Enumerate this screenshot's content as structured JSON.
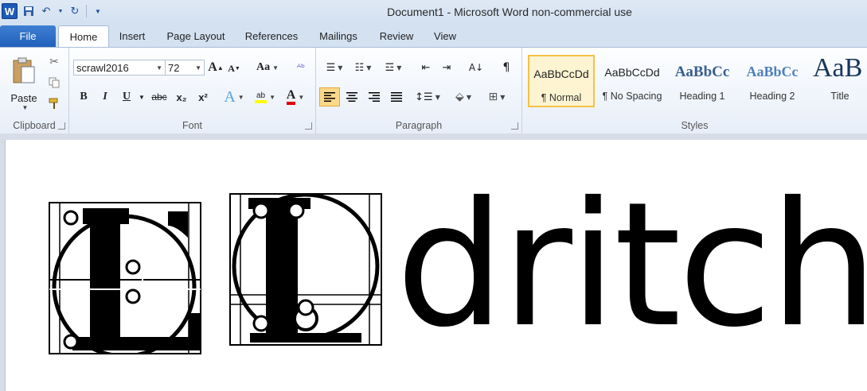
{
  "titlebar": {
    "title": "Document1  -  Microsoft Word non-commercial use",
    "quick_access": [
      "word-logo-icon",
      "save-icon",
      "undo-icon",
      "redo-icon",
      "customize-icon"
    ]
  },
  "tabs": [
    "File",
    "Home",
    "Insert",
    "Page Layout",
    "References",
    "Mailings",
    "Review",
    "View"
  ],
  "active_tab": "Home",
  "clipboard": {
    "paste_label": "Paste",
    "group_label": "Clipboard"
  },
  "font": {
    "name": "scrawl2016",
    "size": "72",
    "group_label": "Font",
    "bold": "B",
    "italic": "I",
    "underline": "U",
    "strike": "abc",
    "sub": "x₂",
    "sup": "x²",
    "grow": "A",
    "shrink": "A",
    "case": "Aa"
  },
  "paragraph": {
    "group_label": "Paragraph"
  },
  "styles": {
    "group_label": "Styles",
    "items": [
      {
        "sample": "AaBbCcDd",
        "name": "¶ Normal"
      },
      {
        "sample": "AaBbCcDd",
        "name": "¶ No Spacing"
      },
      {
        "sample": "AaBbCc",
        "name": "Heading 1"
      },
      {
        "sample": "AaBbCc",
        "name": "Heading 2"
      },
      {
        "sample": "AaB",
        "name": "Title"
      }
    ]
  },
  "document": {
    "text": "dritch",
    "decorated_letters": [
      "L",
      "L"
    ]
  },
  "colors": {
    "accent": "#2b579a",
    "highlight": "#ffff00",
    "font_color": "#e00000",
    "selected_style": "#f5c243"
  }
}
